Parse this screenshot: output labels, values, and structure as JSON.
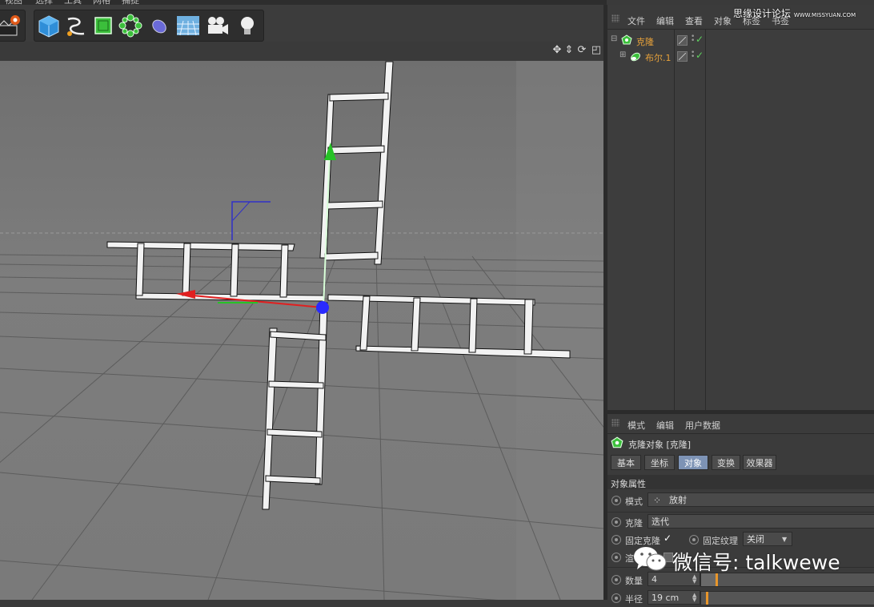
{
  "menubar": {
    "items": [
      "视图",
      "选择",
      "工具",
      "网格",
      "捕捉"
    ]
  },
  "toolbar": {
    "icons": [
      "render-settings-icon",
      "cube-icon",
      "spline-pen-icon",
      "subdivision-surface-icon",
      "array-cloner-icon",
      "deformer-icon",
      "floor-grid-icon",
      "camera-icon",
      "light-bulb-icon"
    ]
  },
  "viewport": {
    "nav_icons": [
      "move-view-icon",
      "zoom-view-icon",
      "rotate-view-icon",
      "maximize-view-icon"
    ]
  },
  "objects_panel": {
    "menu": [
      "文件",
      "编辑",
      "查看",
      "对象",
      "标签",
      "书签"
    ],
    "rows": [
      {
        "name": "克隆",
        "icon": "cloner-icon"
      },
      {
        "name": "布尔.1",
        "icon": "boole-icon"
      }
    ]
  },
  "attributes_panel": {
    "menu": [
      "模式",
      "编辑",
      "用户数据"
    ],
    "object_title": "克隆对象 [克隆]",
    "tabs": [
      "基本",
      "坐标",
      "对象",
      "变换",
      "效果器"
    ],
    "active_tab": "对象",
    "section_title": "对象属性",
    "mode_label": "模式",
    "mode_value": "放射",
    "clone_label": "克隆",
    "clone_value": "迭代",
    "fix_clone_label": "固定克隆",
    "fix_clone_check": "✓",
    "fix_texture_label": "固定纹理",
    "fix_texture_value": "关闭",
    "partial_label": "渲",
    "count_label": "数量",
    "count_value": "4",
    "radius_label": "半径",
    "radius_value": "19 cm"
  },
  "watermark": {
    "text": "微信号: talkwewe"
  },
  "site_mark": {
    "text": "思缘设计论坛",
    "url": "WWW.MISSYUAN.COM"
  },
  "colors": {
    "viewport_bg": "#7a7a7a",
    "panel_bg": "#3b3b3b",
    "active_tab": "#7d93b5",
    "object_name": "#e8a23a",
    "axis_y": "#27c227",
    "axis_x": "#e02020",
    "axis_z": "#2a2aff"
  }
}
